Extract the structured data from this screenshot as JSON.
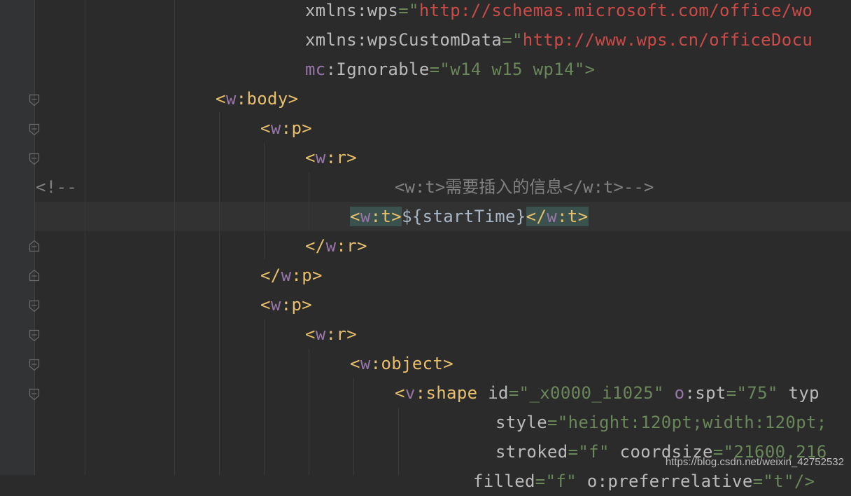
{
  "editor": {
    "line1": {
      "attr": "xmlns:wps",
      "eq": "=\"",
      "url": "http://schemas.microsoft.com/office/wo"
    },
    "line2": {
      "attr": "xmlns:wpsCustomData",
      "eq": "=\"",
      "url": "http://www.wps.cn/officeDocu"
    },
    "line3": {
      "ns": "mc",
      "colon": ":",
      "attr": "Ignorable",
      "eq": "=\"",
      "value": "w14 w15 wp14",
      "close": "\">"
    },
    "line4": {
      "open": "<",
      "ns": "w",
      "colon": ":",
      "name": "body",
      "close": ">"
    },
    "line5": {
      "open": "<",
      "ns": "w",
      "colon": ":",
      "name": "p",
      "close": ">"
    },
    "line6": {
      "open": "<",
      "ns": "w",
      "colon": ":",
      "name": "r",
      "close": ">"
    },
    "line7": {
      "prefix": "<!--",
      "comment": "<w:t>需要插入的信息</w:t>-->"
    },
    "line8": {
      "open": "<",
      "ns": "w",
      "colon": ":",
      "name": "t",
      "close": ">",
      "text": "${startTime}",
      "endopen": "</",
      "endns": "w",
      "endcolon": ":",
      "endname": "t",
      "endclose": ">"
    },
    "line9": {
      "open": "</",
      "ns": "w",
      "colon": ":",
      "name": "r",
      "close": ">"
    },
    "line10": {
      "open": "</",
      "ns": "w",
      "colon": ":",
      "name": "p",
      "close": ">"
    },
    "line11": {
      "open": "<",
      "ns": "w",
      "colon": ":",
      "name": "p",
      "close": ">"
    },
    "line12": {
      "open": "<",
      "ns": "w",
      "colon": ":",
      "name": "r",
      "close": ">"
    },
    "line13": {
      "open": "<",
      "ns": "w",
      "colon": ":",
      "name": "object",
      "close": ">"
    },
    "line14": {
      "open": "<",
      "ns": "v",
      "colon": ":",
      "name": "shape",
      "a1": " id",
      "eq1": "=\"",
      "v1": "_x0000_i1025",
      "q1": "\" ",
      "a2ns": "o",
      "a2colon": ":",
      "a2": "spt",
      "eq2": "=\"",
      "v2": "75",
      "q2": "\" ",
      "a3": "typ"
    },
    "line15": {
      "attr": "style",
      "eq": "=\"",
      "value": "height:120pt;width:120pt;"
    },
    "line16": {
      "attr": "stroked",
      "eq": "=\"",
      "value": "f",
      "q": "\" ",
      "attr2": "coordsize",
      "eq2": "=\"",
      "value2": "21600,216"
    },
    "line17": {
      "attr": "filled",
      "eq": "=\"",
      "value": "f",
      "q": "\" ",
      "attr2": "o:preferrelative",
      "eq2": "=\"",
      "value2": "t",
      "close": "\"/>"
    }
  },
  "watermark": "https://blog.csdn.net/weixin_42752532"
}
